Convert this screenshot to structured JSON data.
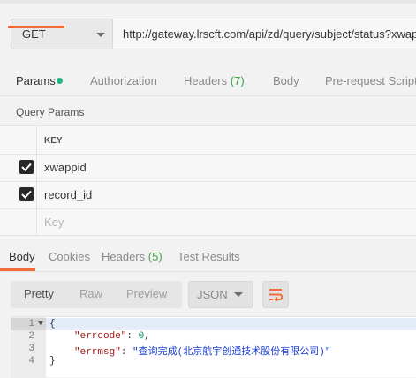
{
  "request": {
    "method": "GET",
    "url": "http://gateway.lrscft.com/api/zd/query/subject/status?xwappid"
  },
  "request_tabs": {
    "params": "Params",
    "authorization": "Authorization",
    "headers": "Headers",
    "headers_count": "(7)",
    "body": "Body",
    "prerequest": "Pre-request Script"
  },
  "query_params": {
    "title": "Query Params",
    "key_header": "KEY",
    "rows": [
      {
        "key": "xwappid",
        "checked": true
      },
      {
        "key": "record_id",
        "checked": true
      }
    ],
    "new_key_placeholder": "Key"
  },
  "response_tabs": {
    "body": "Body",
    "cookies": "Cookies",
    "headers": "Headers",
    "headers_count": "(5)",
    "test_results": "Test Results"
  },
  "toolbar": {
    "pretty": "Pretty",
    "raw": "Raw",
    "preview": "Preview",
    "format": "JSON"
  },
  "response_body": {
    "line_numbers": [
      "1",
      "2",
      "3",
      "4"
    ],
    "open_brace": "{",
    "errcode_key": "\"errcode\"",
    "errcode_value": "0",
    "errmsg_key": "\"errmsg\"",
    "errmsg_value": "\"查询完成(北京航宇创通技术股份有限公司)\"",
    "close_brace": "}"
  },
  "colors": {
    "accent": "#f26b3a",
    "params_dot": "#26b47f",
    "count_green": "#3ea641"
  }
}
